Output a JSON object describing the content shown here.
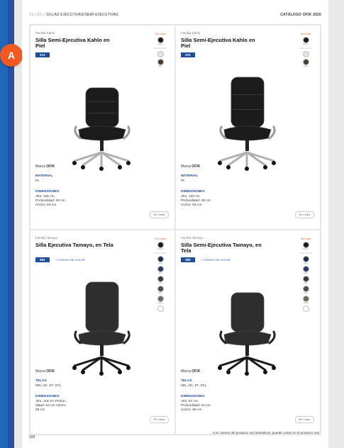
{
  "badge": "A",
  "header": {
    "crumb_muted": "SILLAS //",
    "crumb": "SILLAS EJECUTIVAS/SEMI-EJECUTIVAS",
    "catalog": "CATÁLOGO OFIK 2020"
  },
  "products": [
    {
      "family": "Familia Kahlo",
      "name": "Silla Semi-Ejecutiva Kahlo en Piel",
      "code": "374",
      "color_code": "",
      "swatch_head": "Sin Línea",
      "swatches": [
        {
          "color": "#1a1a1a",
          "label": "Negro"
        },
        {
          "color": "#e6e6e6",
          "label": ""
        },
        {
          "color": "#4a3b2f",
          "label": "Café"
        }
      ],
      "swatch_sub": "Sobre Pedido",
      "brand_label": "Marca",
      "brand": "OFIK",
      "material_title": "MATERIAL",
      "material": "PL",
      "dims_title": "DIMENSIONES",
      "dims": "Alto: 105 cm\nProfundidad: 48 cm\nAncho: 53 cm",
      "online": "En Línea"
    },
    {
      "family": "Familia Kahlo",
      "name": "Silla Semi-Ejecutiva Kahlo en Piel",
      "code": "375",
      "color_code": "",
      "swatch_head": "Sin Línea",
      "swatches": [
        {
          "color": "#1a1a1a",
          "label": "Negro"
        },
        {
          "color": "#e6e6e6",
          "label": ""
        },
        {
          "color": "#4a3b2f",
          "label": "Café"
        }
      ],
      "swatch_sub": "Sobre Pedido",
      "brand_label": "Marca",
      "brand": "OFIK",
      "material_title": "MATERIAL",
      "material": "PL",
      "dims_title": "DIMENSIONES",
      "dims": "Alto: 122 cm\nProfundidad: 48 cm\nAncho: 53 cm",
      "online": "En Línea"
    },
    {
      "family": "Familia Tamayo",
      "name": "Silla Ejecutiva Tamayo, en Tela",
      "code": "391",
      "color_code": "+ CÓDIGO DE COLOR",
      "swatch_head": "Sin Línea",
      "swatches": [
        {
          "color": "#1a1a1a",
          "label": "Negro"
        },
        {
          "color": "#1f2d4f",
          "label": "Azul"
        },
        {
          "color": "#2c3b62",
          "label": "Azul"
        },
        {
          "color": "#3a3a3a",
          "label": "Gris"
        },
        {
          "color": "#4d4d4d",
          "label": "Gris"
        },
        {
          "color": "#6b6b5a",
          "label": "Verde"
        },
        {
          "color": "#ffffff",
          "label": ""
        }
      ],
      "swatch_sub": "Sobre Pedido",
      "brand_label": "Marca",
      "brand": "OFIK",
      "material_title": "TELAS",
      "material": "MN, AD, ST, STL",
      "dims_title": "DIMENSIONES",
      "dims": "Alto: 118 cm Profun-\ndidad: 54 cm Ancho:\n68 cm",
      "online": "En Línea"
    },
    {
      "family": "Familia Tamayo",
      "name": "Silla Semi-Ejecutiva Tamayo, en Tela",
      "code": "395",
      "color_code": "+ CÓDIGO DE COLOR",
      "swatch_head": "Sin Línea",
      "swatches": [
        {
          "color": "#1a1a1a",
          "label": "Negro"
        },
        {
          "color": "#1f2d4f",
          "label": "Azul"
        },
        {
          "color": "#2c3b62",
          "label": "Azul"
        },
        {
          "color": "#3a3a3a",
          "label": "Gris"
        },
        {
          "color": "#4d4d4d",
          "label": "Gris"
        },
        {
          "color": "#6b6b5a",
          "label": "Verde"
        },
        {
          "color": "#ffffff",
          "label": ""
        }
      ],
      "swatch_sub": "Sobre Pedido",
      "brand_label": "Marca",
      "brand": "OFIK",
      "material_title": "TELAS",
      "material": "MN, AD, ST, STL",
      "dims_title": "DIMENSIONES",
      "dims": "Alto: 97 cm\nProfundidad: 54 cm\nAncho: 68 cm",
      "online": "En Línea"
    }
  ],
  "footer": {
    "page": "028",
    "note": "*Los colores del producto son ilustrativos, pueden variar en el producto real."
  }
}
